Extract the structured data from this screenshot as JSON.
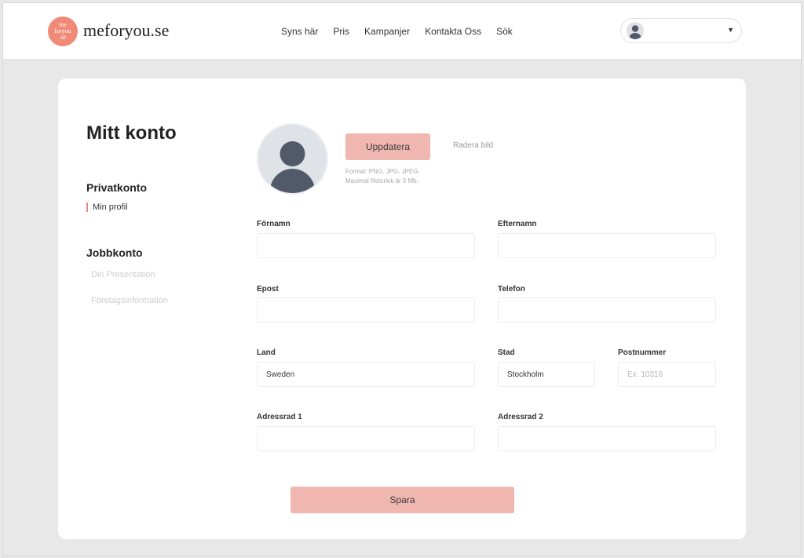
{
  "header": {
    "logo_mark_lines": [
      "me",
      "foryou",
      ".se"
    ],
    "logo_text": "meforyou.se",
    "nav": [
      "Syns här",
      "Pris",
      "Kampanjer",
      "Kontakta Oss",
      "Sök"
    ]
  },
  "sidebar": {
    "title": "Mitt konto",
    "private_heading": "Privatkonto",
    "private_items": [
      "Min profil"
    ],
    "job_heading": "Jobbkonto",
    "job_items": [
      "Din Presentation",
      "Företagsinformation"
    ]
  },
  "avatar_section": {
    "update_label": "Uppdatera",
    "delete_label": "Radera bild",
    "hint_line1": "Format: PNG, JPG, JPEG.",
    "hint_line2": "Maximal filstorlek är 5 Mb."
  },
  "form": {
    "first_name": {
      "label": "Förnamn",
      "value": ""
    },
    "last_name": {
      "label": "Efternamn",
      "value": ""
    },
    "email": {
      "label": "Epost",
      "value": ""
    },
    "phone": {
      "label": "Telefon",
      "value": ""
    },
    "country": {
      "label": "Land",
      "value": "Sweden"
    },
    "city": {
      "label": "Stad",
      "value": "Stockholm"
    },
    "postal": {
      "label": "Postnummer",
      "value": "",
      "placeholder": "Ex. 10316"
    },
    "address1": {
      "label": "Adressrad 1",
      "value": ""
    },
    "address2": {
      "label": "Adressrad 2",
      "value": ""
    },
    "save_label": "Spara"
  },
  "colors": {
    "accent": "#f0b7b1",
    "logo": "#f08a76",
    "active_marker": "#e48b7e"
  }
}
